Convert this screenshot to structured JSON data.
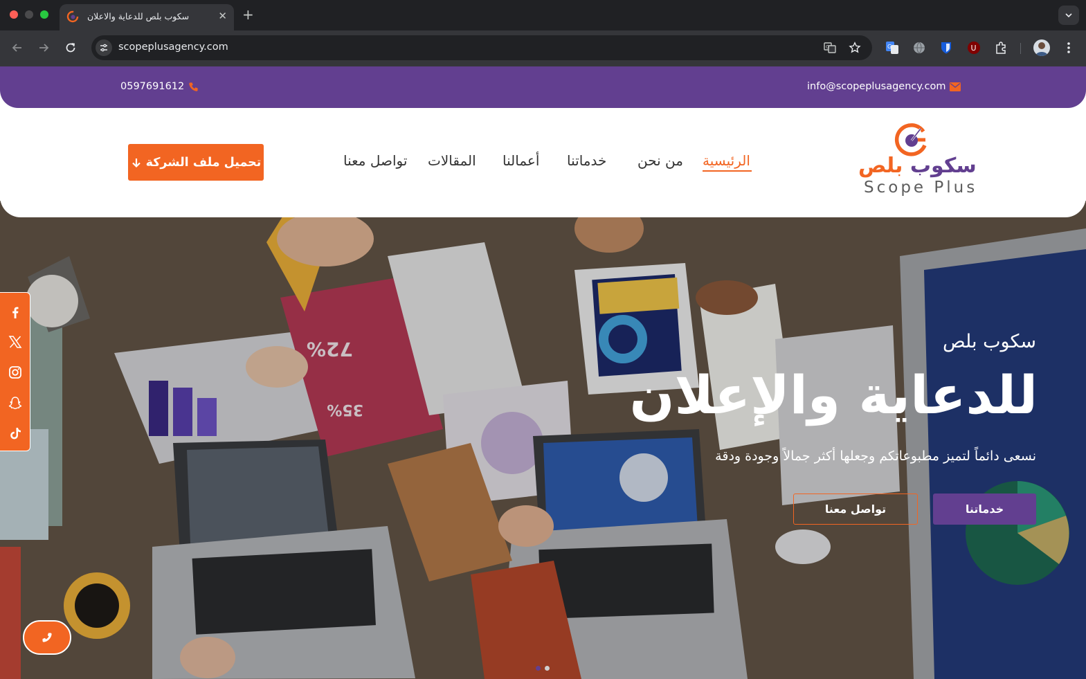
{
  "browser": {
    "tab_title": "سكوب بلص للدعاية والاعلان",
    "url": "scopeplusagency.com"
  },
  "topbar": {
    "phone": "0597691612",
    "email": "info@scopeplusagency.com"
  },
  "header": {
    "logo_ar_word1": "سكوب",
    "logo_ar_word2": "بلص",
    "logo_en": "Scope Plus",
    "nav": {
      "home": "الرئيسية",
      "about": "من نحن",
      "services": "خدماتنا",
      "works": "أعمالنا",
      "articles": "المقالات",
      "contact": "تواصل معنا"
    },
    "download_label": "تحميل ملف الشركة"
  },
  "hero": {
    "subtitle": "سكوب بلص",
    "title": "للدعاية والإعلان",
    "description": "نسعى دائماً لتميز مطبوعاتكم وجعلها أكثر جمالاً وجودة ودقة",
    "services_button": "خدماتنا",
    "contact_button": "تواصل معنا",
    "slides_count": 2,
    "active_slide": 1
  },
  "social": [
    "facebook-icon",
    "x-icon",
    "instagram-icon",
    "snapchat-icon",
    "tiktok-icon"
  ],
  "colors": {
    "purple": "#623f90",
    "orange": "#f26522"
  }
}
